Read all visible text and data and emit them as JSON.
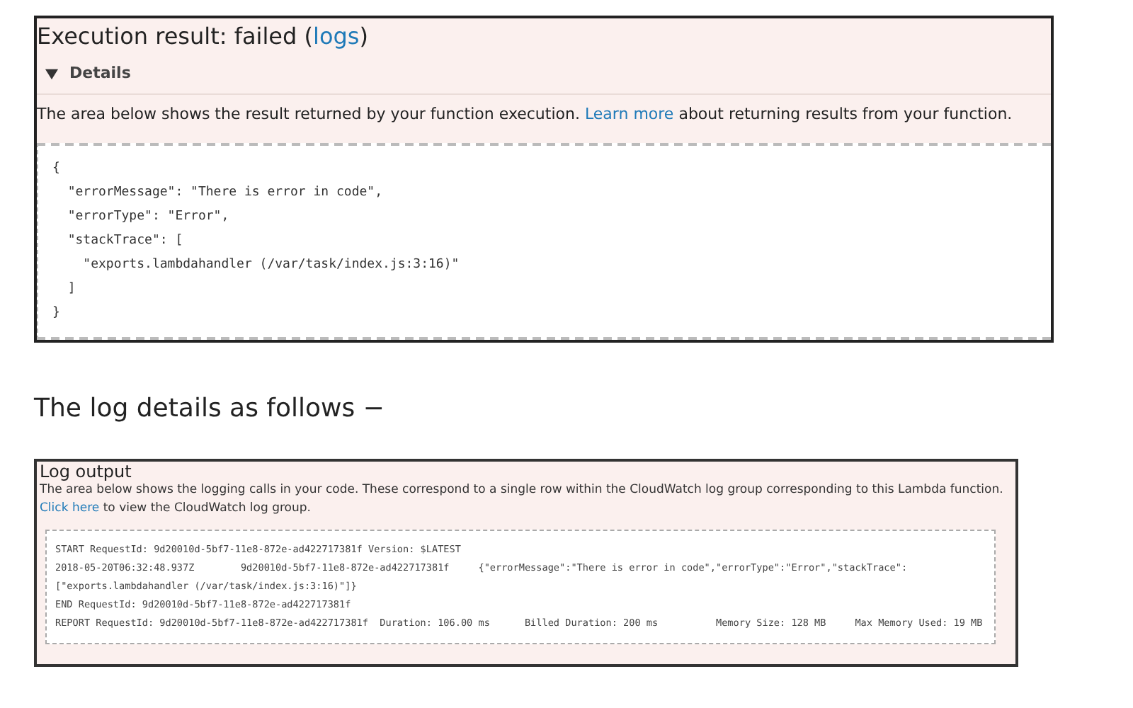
{
  "result_panel": {
    "title": "Execution result: failed (",
    "title_link": "logs",
    "title_end": ")",
    "details": {
      "label": "Details",
      "expanded": true
    },
    "description": {
      "before": "The area below shows the result returned by your function execution.",
      "link": "Learn more",
      "after": "about returning results from your function."
    },
    "code_lines": [
      "{",
      "  \"errorMessage\": \"There is error in code\",",
      "  \"errorType\": \"Error\",",
      "  \"stackTrace\": [",
      "    \"exports.lambdahandler (/var/task/index.js:3:16)\"",
      "  ]",
      "}"
    ]
  },
  "heading": "The log details as follows −",
  "log_panel": {
    "title": "Log output",
    "description": {
      "before": "The area below shows the logging calls in your code. These correspond to a single row within the CloudWatch log group corresponding to this Lambda function.",
      "link": "Click here",
      "after": "to view the CloudWatch log group."
    },
    "log_lines": [
      "START RequestId: 9d20010d-5bf7-11e8-872e-ad422717381f Version: $LATEST",
      "2018-05-20T06:32:48.937Z        9d20010d-5bf7-11e8-872e-ad422717381f     {\"errorMessage\":\"There is error in code\",\"errorType\":\"Error\",\"stackTrace\":",
      "[\"exports.lambdahandler (/var/task/index.js:3:16)\"]}",
      "END RequestId: 9d20010d-5bf7-11e8-872e-ad422717381f",
      "REPORT RequestId: 9d20010d-5bf7-11e8-872e-ad422717381f  Duration: 106.00 ms      Billed Duration: 200 ms          Memory Size: 128 MB     Max Memory Used: 19 MB"
    ]
  }
}
